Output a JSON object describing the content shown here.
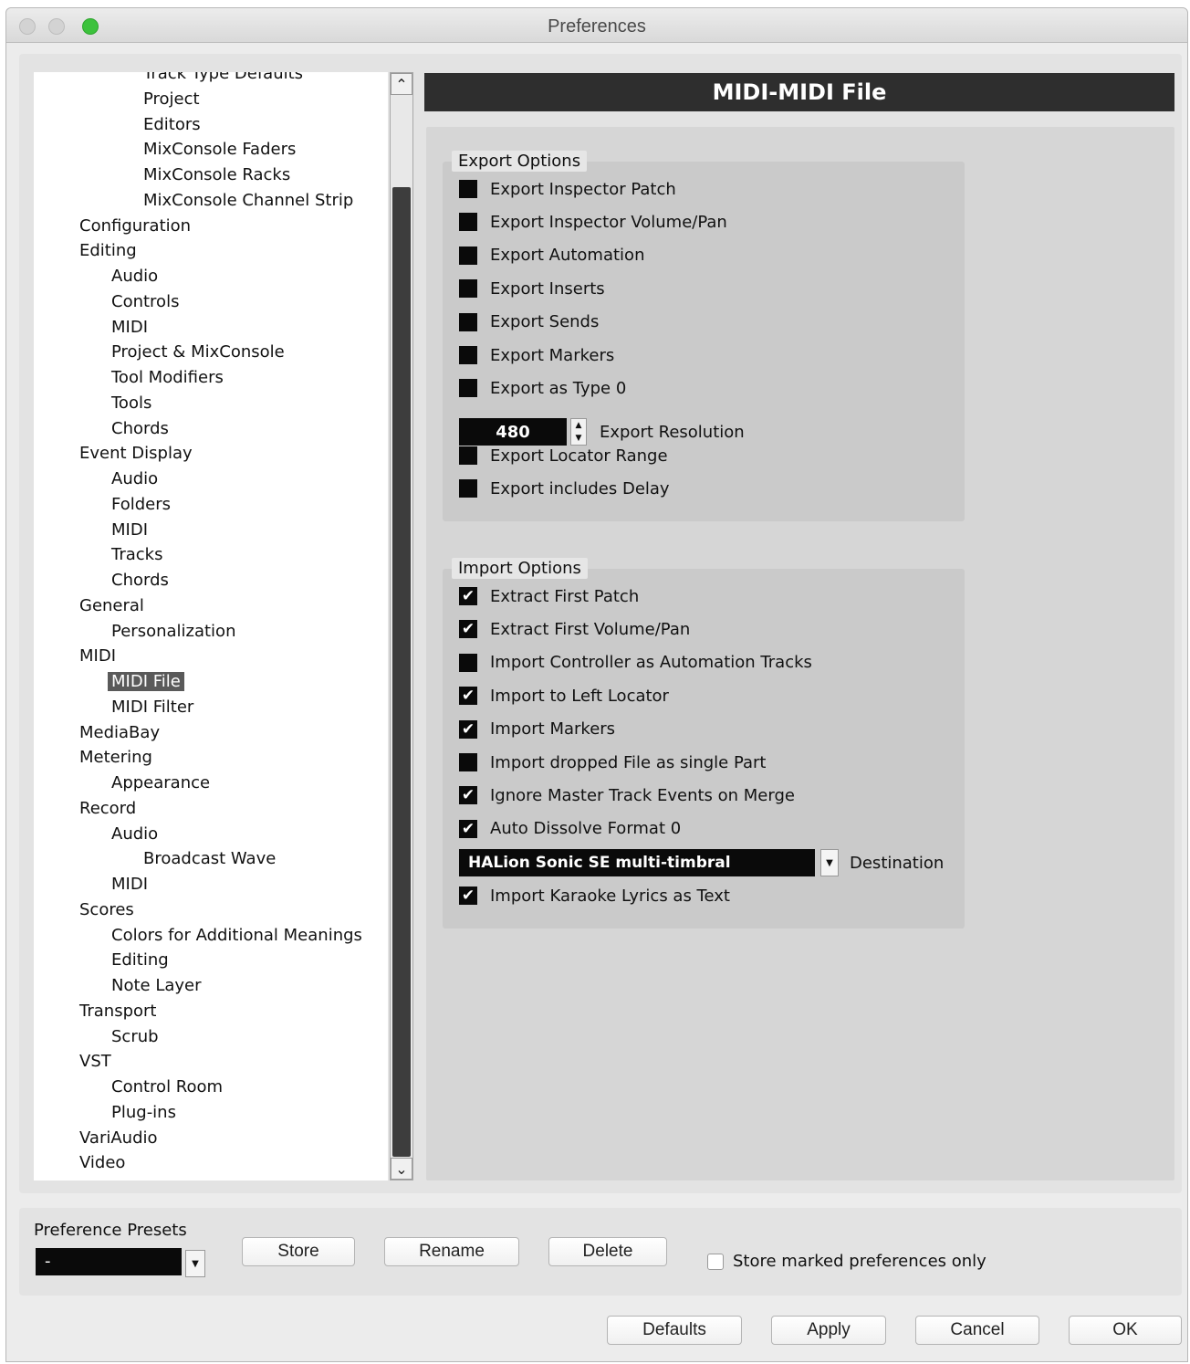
{
  "window": {
    "title": "Preferences"
  },
  "tree": {
    "items": [
      {
        "label": "Track Type Defaults",
        "level": 2
      },
      {
        "label": "Project",
        "level": 2
      },
      {
        "label": "Editors",
        "level": 2
      },
      {
        "label": "MixConsole Faders",
        "level": 2
      },
      {
        "label": "MixConsole Racks",
        "level": 2
      },
      {
        "label": "MixConsole Channel Strip",
        "level": 2
      },
      {
        "label": "Configuration",
        "level": 0
      },
      {
        "label": "Editing",
        "level": 0
      },
      {
        "label": "Audio",
        "level": 1
      },
      {
        "label": "Controls",
        "level": 1
      },
      {
        "label": "MIDI",
        "level": 1
      },
      {
        "label": "Project & MixConsole",
        "level": 1
      },
      {
        "label": "Tool Modifiers",
        "level": 1
      },
      {
        "label": "Tools",
        "level": 1
      },
      {
        "label": "Chords",
        "level": 1
      },
      {
        "label": "Event Display",
        "level": 0
      },
      {
        "label": "Audio",
        "level": 1
      },
      {
        "label": "Folders",
        "level": 1
      },
      {
        "label": "MIDI",
        "level": 1
      },
      {
        "label": "Tracks",
        "level": 1
      },
      {
        "label": "Chords",
        "level": 1
      },
      {
        "label": "General",
        "level": 0
      },
      {
        "label": "Personalization",
        "level": 1
      },
      {
        "label": "MIDI",
        "level": 0
      },
      {
        "label": "MIDI File",
        "level": 1,
        "selected": true
      },
      {
        "label": "MIDI Filter",
        "level": 1
      },
      {
        "label": "MediaBay",
        "level": 0
      },
      {
        "label": "Metering",
        "level": 0
      },
      {
        "label": "Appearance",
        "level": 1
      },
      {
        "label": "Record",
        "level": 0
      },
      {
        "label": "Audio",
        "level": 1
      },
      {
        "label": "Broadcast Wave",
        "level": 2
      },
      {
        "label": "MIDI",
        "level": 1
      },
      {
        "label": "Scores",
        "level": 0
      },
      {
        "label": "Colors for Additional Meanings",
        "level": 1
      },
      {
        "label": "Editing",
        "level": 1
      },
      {
        "label": "Note Layer",
        "level": 1
      },
      {
        "label": "Transport",
        "level": 0
      },
      {
        "label": "Scrub",
        "level": 1
      },
      {
        "label": "VST",
        "level": 0
      },
      {
        "label": "Control Room",
        "level": 1
      },
      {
        "label": "Plug-ins",
        "level": 1
      },
      {
        "label": "VariAudio",
        "level": 0
      },
      {
        "label": "Video",
        "level": 0
      }
    ]
  },
  "page": {
    "header": "MIDI-MIDI File"
  },
  "export_options": {
    "label": "Export Options",
    "options": [
      {
        "label": "Export Inspector Patch",
        "checked": false
      },
      {
        "label": "Export Inspector Volume/Pan",
        "checked": false
      },
      {
        "label": "Export Automation",
        "checked": false
      },
      {
        "label": "Export Inserts",
        "checked": false
      },
      {
        "label": "Export Sends",
        "checked": false
      },
      {
        "label": "Export Markers",
        "checked": false
      },
      {
        "label": "Export as Type 0",
        "checked": false
      }
    ],
    "resolution": {
      "value": "480",
      "label": "Export Resolution"
    },
    "options_after": [
      {
        "label": "Export Locator Range",
        "checked": false
      },
      {
        "label": "Export includes Delay",
        "checked": false
      }
    ]
  },
  "import_options": {
    "label": "Import Options",
    "options": [
      {
        "label": "Extract First Patch",
        "checked": true
      },
      {
        "label": "Extract First Volume/Pan",
        "checked": true
      },
      {
        "label": "Import Controller as Automation Tracks",
        "checked": false
      },
      {
        "label": "Import to Left Locator",
        "checked": true
      },
      {
        "label": "Import Markers",
        "checked": true
      },
      {
        "label": "Import dropped File as single Part",
        "checked": false
      },
      {
        "label": "Ignore Master Track Events on Merge",
        "checked": true
      },
      {
        "label": "Auto Dissolve Format 0",
        "checked": true
      }
    ],
    "destination": {
      "value": "HALion Sonic SE multi-timbral",
      "label": "Destination"
    },
    "options_after": [
      {
        "label": "Import Karaoke Lyrics as Text",
        "checked": true
      }
    ]
  },
  "presets": {
    "label": "Preference Presets",
    "selected": "-",
    "store_label": "Store",
    "rename_label": "Rename",
    "delete_label": "Delete",
    "store_marked_label": "Store marked preferences only"
  },
  "footer": {
    "defaults_label": "Defaults",
    "apply_label": "Apply",
    "cancel_label": "Cancel",
    "ok_label": "OK"
  }
}
